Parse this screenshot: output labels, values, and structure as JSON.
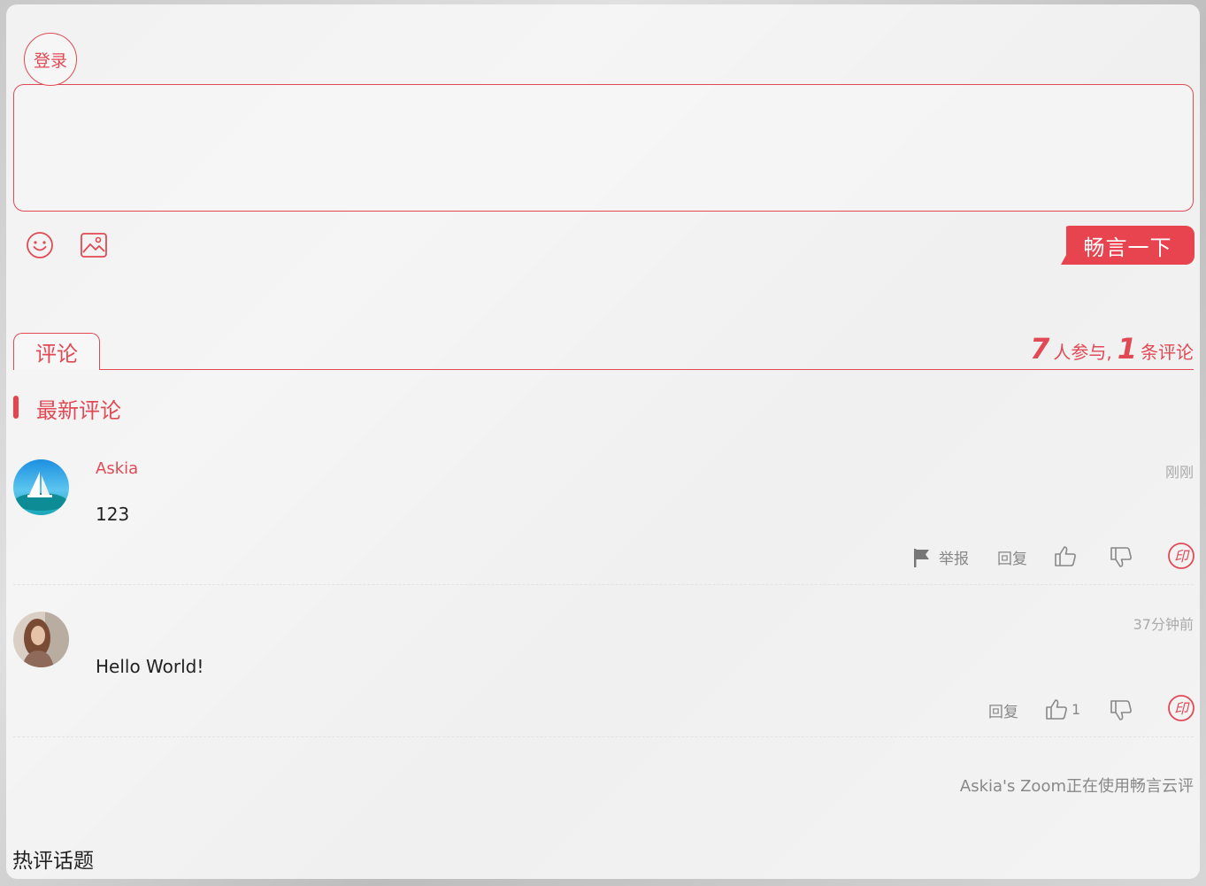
{
  "login": {
    "label": "登录"
  },
  "editor": {
    "emoji_icon": "smiley-icon",
    "image_icon": "image-icon",
    "submit_label": "畅言一下"
  },
  "tabs": {
    "comments_label": "评论"
  },
  "stats": {
    "participants": "7",
    "participants_suffix": "人参与,",
    "comments": "1",
    "comments_suffix": "条评论"
  },
  "latest": {
    "title": "最新评论"
  },
  "comments": [
    {
      "username": "Askia",
      "text": "123",
      "time": "刚刚",
      "report_label": "举报",
      "reply_label": "回复",
      "likes": "",
      "icons": [
        "flag-icon",
        "thumbs-up-icon",
        "thumbs-down-icon",
        "share-stamp-icon"
      ]
    },
    {
      "username": "",
      "text": "Hello World!",
      "time": "37分钟前",
      "reply_label": "回复",
      "likes": "1",
      "icons": [
        "thumbs-up-icon",
        "thumbs-down-icon",
        "share-stamp-icon"
      ]
    }
  ],
  "footer": {
    "note": "Askia's Zoom正在使用畅言云评"
  },
  "hot": {
    "title": "热评话题"
  },
  "colors": {
    "accent": "#e14a55",
    "button": "#e8444f"
  }
}
